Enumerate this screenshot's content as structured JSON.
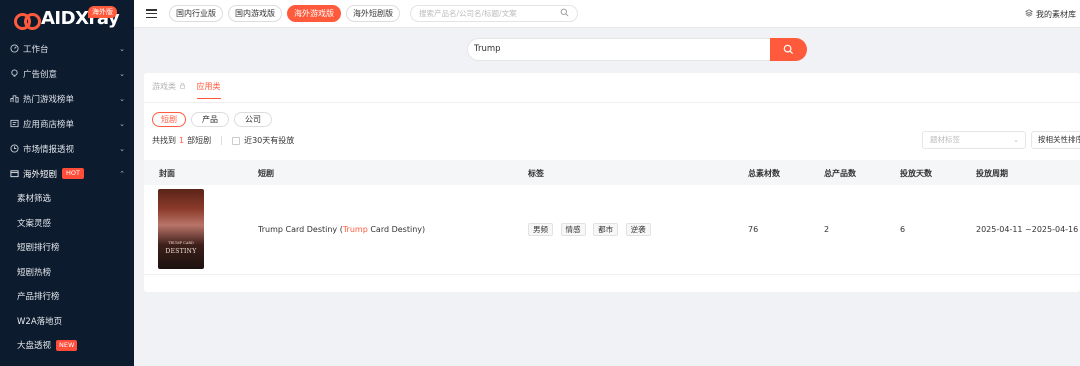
{
  "brand": {
    "logo_text": "AIDXray",
    "badge": "海外版"
  },
  "sidebar": {
    "items": [
      {
        "label": "工作台",
        "icon": "dashboard-icon"
      },
      {
        "label": "广告创意",
        "icon": "lightbulb-icon"
      },
      {
        "label": "热门游戏榜单",
        "icon": "ranking-icon"
      },
      {
        "label": "应用商店榜单",
        "icon": "store-icon"
      },
      {
        "label": "市场情报透视",
        "icon": "clock-icon"
      },
      {
        "label": "海外短剧",
        "icon": "drama-icon",
        "badge": "HOT"
      }
    ],
    "sub_items": [
      {
        "label": "素材筛选"
      },
      {
        "label": "文案灵感"
      },
      {
        "label": "短剧排行榜"
      },
      {
        "label": "短剧热榜"
      },
      {
        "label": "产品排行榜"
      },
      {
        "label": "W2A落地页"
      },
      {
        "label": "大盘透视",
        "badge": "NEW"
      }
    ]
  },
  "topbar": {
    "tabs": [
      "国内行业版",
      "国内游戏版",
      "海外游戏版",
      "海外短剧版"
    ],
    "active_tab": "海外游戏版",
    "search_placeholder": "搜索产品名/公司名/标题/文案",
    "right_text": "我的素材库"
  },
  "search": {
    "value": "Trump"
  },
  "category_tabs": [
    "游戏类",
    "应用类"
  ],
  "type_chips": [
    "短剧",
    "产品",
    "公司"
  ],
  "results": {
    "prefix": "共找到",
    "count": "1",
    "suffix": "部短剧",
    "filter": "近30天有投放"
  },
  "filters": {
    "tag_placeholder": "题材标签",
    "sort_label": "按相关性排序"
  },
  "table": {
    "headers": [
      "封面",
      "短剧",
      "标签",
      "总素材数",
      "总产品数",
      "投放天数",
      "投放周期"
    ],
    "rows": [
      {
        "cover_title": "DESTINY",
        "cover_subtitle": "TRUMP CARD",
        "title_main": "Trump Card Destiny (",
        "title_highlight": "Trump",
        "title_rest": " Card Destiny)",
        "tags": [
          "男频",
          "情感",
          "都市",
          "逆袭"
        ],
        "total_materials": "76",
        "total_products": "2",
        "days": "6",
        "period": "2025-04-11 ~2025-04-16"
      }
    ]
  },
  "colors": {
    "accent": "#ff5a3c",
    "sidebar_bg": "#0d1b2e"
  }
}
